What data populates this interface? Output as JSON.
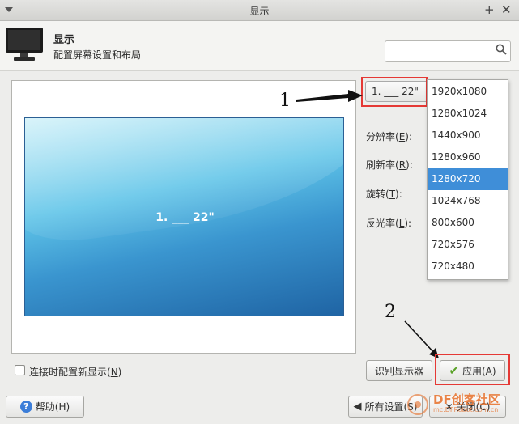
{
  "window": {
    "title": "显示"
  },
  "header": {
    "title": "显示",
    "subtitle": "配置屏幕设置和布局",
    "search_placeholder": ""
  },
  "preview": {
    "monitor_label": "1. ___ 22\""
  },
  "settings": {
    "monitor_select": "1. ___ 22\"",
    "resolution_label": "分辨率(",
    "resolution_key": "E",
    "resolution_suffix": "):",
    "refresh_label": "刷新率(",
    "refresh_key": "R",
    "refresh_suffix": "):",
    "rotation_label": "旋转(",
    "rotation_key": "T",
    "rotation_suffix": "):",
    "reflect_label": "反光率(",
    "reflect_key": "L",
    "reflect_suffix": "):"
  },
  "resolution_dropdown": {
    "options": [
      "1920x1080",
      "1280x1024",
      "1440x900",
      "1280x960",
      "1280x720",
      "1024x768",
      "800x600",
      "720x576",
      "720x480"
    ],
    "selected": "1280x720"
  },
  "annotations": {
    "label_1": "1",
    "label_2": "2"
  },
  "footer": {
    "reconfigure_checkbox_label": "连接时配置新显示(",
    "reconfigure_key": "N",
    "reconfigure_suffix": ")",
    "reconfigure_checked": false,
    "identify_button": "识别显示器",
    "apply_button": "应用(A)",
    "help_button": "帮助(H)",
    "all_settings_button": "所有设置(S)",
    "close_button": "关闭(C)"
  },
  "watermark": {
    "text": "DF创客社区",
    "sub": "mc.DFRobot.com.cn"
  },
  "colors": {
    "accent": "#3f8ed8",
    "highlight_box": "#e53935",
    "apply_check": "#5aa227"
  }
}
